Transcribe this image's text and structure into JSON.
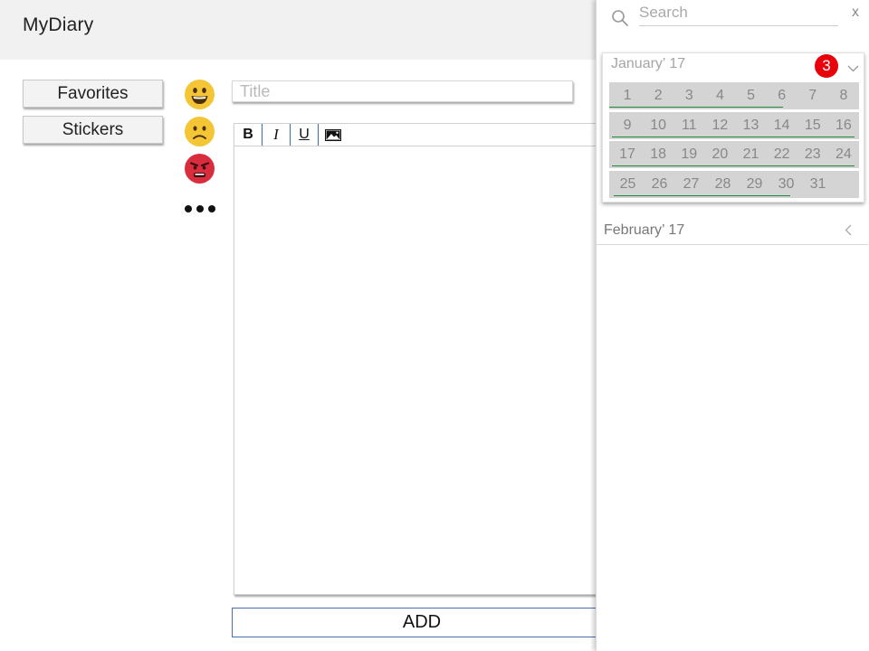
{
  "header": {
    "app_title": "MyDiary"
  },
  "nav": {
    "favorites_label": "Favorites",
    "stickers_label": "Stickers"
  },
  "moods": {
    "items": [
      "happy-face",
      "sad-face",
      "angry-face"
    ],
    "more_icon": "more-dots"
  },
  "editor": {
    "title_placeholder": "Title",
    "toolbar": {
      "bold": "B",
      "italic": "I",
      "underline": "U",
      "image_icon": "image-icon"
    }
  },
  "add_button_label": "ADD",
  "panel": {
    "search_placeholder": "Search",
    "close_label": "x",
    "months": [
      {
        "title": "January’ 17",
        "badge": "3",
        "expanded": true,
        "weeks": [
          [
            "1",
            "2",
            "3",
            "4",
            "5",
            "6",
            "7",
            "8"
          ],
          [
            "9",
            "10",
            "11",
            "12",
            "13",
            "14",
            "15",
            "16"
          ],
          [
            "17",
            "18",
            "19",
            "20",
            "21",
            "22",
            "23",
            "24"
          ],
          [
            "25",
            "26",
            "27",
            "28",
            "29",
            "30",
            "31"
          ]
        ]
      },
      {
        "title": "February’ 17",
        "expanded": false
      }
    ]
  },
  "colors": {
    "header_bg": "#f1f1f1",
    "badge": "#e8000b",
    "week_bg": "#d4d4d4",
    "entry_underline": "#1f8a3a",
    "happy_face": "#f4c534",
    "angry_face": "#d92d3e"
  }
}
